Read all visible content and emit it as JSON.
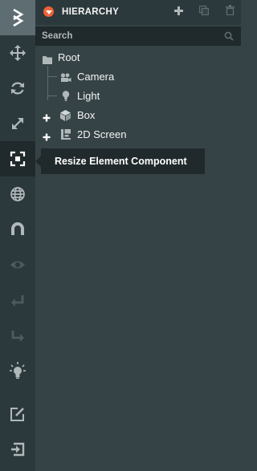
{
  "colors": {
    "toolbar_bg": "#2c393c",
    "panel_bg": "#364346",
    "dark_bg": "#20292b",
    "accent": "#f06237",
    "icon": "#b1b8ba",
    "text": "#f4f4f4"
  },
  "toolbar": {
    "logo_icon": "playcanvas-logo-icon",
    "tools": [
      {
        "name": "translate-tool",
        "icon": "move-icon"
      },
      {
        "name": "rotate-tool",
        "icon": "rotate-icon"
      },
      {
        "name": "scale-tool",
        "icon": "scale-icon"
      },
      {
        "name": "resize-element-tool",
        "icon": "resize-element-icon",
        "active": true
      },
      {
        "name": "world-local-toggle",
        "icon": "globe-icon"
      },
      {
        "name": "snap-toggle",
        "icon": "magnet-icon"
      },
      {
        "name": "focus-tool",
        "icon": "eye-icon",
        "disabled": true
      },
      {
        "name": "undo-tool",
        "icon": "undo-icon",
        "disabled": true
      },
      {
        "name": "redo-tool",
        "icon": "redo-icon",
        "disabled": true
      },
      {
        "name": "lightmapper-tool",
        "icon": "lightbulb-icon"
      },
      {
        "name": "code-editor-tool",
        "icon": "edit-icon"
      },
      {
        "name": "publish-tool",
        "icon": "publish-icon"
      }
    ]
  },
  "hierarchy": {
    "title": "HIERARCHY",
    "search_placeholder": "Search",
    "items": [
      {
        "label": "Root",
        "icon": "folder-icon",
        "expander": false
      },
      {
        "label": "Camera",
        "icon": "camera-icon",
        "expander": false
      },
      {
        "label": "Light",
        "icon": "light-icon",
        "expander": false
      },
      {
        "label": "Box",
        "icon": "cube-icon",
        "expander": "+"
      },
      {
        "label": "2D Screen",
        "icon": "screen-icon",
        "expander": "+"
      }
    ]
  },
  "tooltip": {
    "text": "Resize Element Component"
  }
}
